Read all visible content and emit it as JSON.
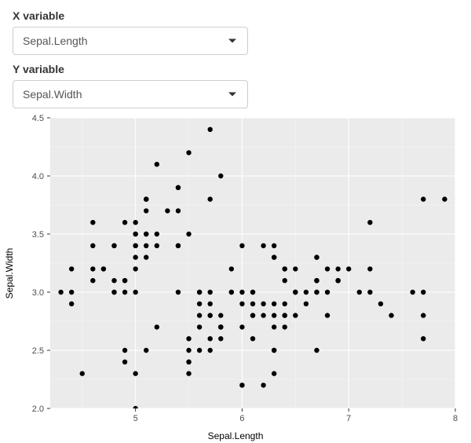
{
  "controls": {
    "x": {
      "label": "X variable",
      "value": "Sepal.Length"
    },
    "y": {
      "label": "Y variable",
      "value": "Sepal.Width"
    }
  },
  "chart_data": {
    "type": "scatter",
    "title": "",
    "xlabel": "Sepal.Length",
    "ylabel": "Sepal.Width",
    "xlim": [
      4.2,
      8.0
    ],
    "ylim": [
      2.0,
      4.5
    ],
    "x_ticks": [
      5,
      6,
      7,
      8
    ],
    "y_ticks": [
      2.0,
      2.5,
      3.0,
      3.5,
      4.0,
      4.5
    ],
    "series": [
      {
        "name": "points",
        "x": [
          5.1,
          4.9,
          4.7,
          4.6,
          5.0,
          5.4,
          4.6,
          5.0,
          4.4,
          4.9,
          5.4,
          4.8,
          4.8,
          4.3,
          5.8,
          5.7,
          5.4,
          5.1,
          5.7,
          5.1,
          5.4,
          5.1,
          4.6,
          5.1,
          4.8,
          5.0,
          5.0,
          5.2,
          5.2,
          4.7,
          4.8,
          5.4,
          5.2,
          5.5,
          4.9,
          5.0,
          5.5,
          4.9,
          4.4,
          5.1,
          5.0,
          4.5,
          4.4,
          5.0,
          5.1,
          4.8,
          5.1,
          4.6,
          5.3,
          5.0,
          7.0,
          6.4,
          6.9,
          5.5,
          6.5,
          5.7,
          6.3,
          4.9,
          6.6,
          5.2,
          5.0,
          5.9,
          6.0,
          6.1,
          5.6,
          6.7,
          5.6,
          5.8,
          6.2,
          5.6,
          5.9,
          6.1,
          6.3,
          6.1,
          6.4,
          6.6,
          6.8,
          6.7,
          6.0,
          5.7,
          5.5,
          5.5,
          5.8,
          6.0,
          5.4,
          6.0,
          6.7,
          6.3,
          5.6,
          5.5,
          5.5,
          6.1,
          5.8,
          5.0,
          5.6,
          5.7,
          5.7,
          6.2,
          5.1,
          5.7,
          6.3,
          5.8,
          7.1,
          6.3,
          6.5,
          7.6,
          4.9,
          7.3,
          6.7,
          7.2,
          6.5,
          6.4,
          6.8,
          5.7,
          5.8,
          6.4,
          6.5,
          7.7,
          7.7,
          6.0,
          6.9,
          5.6,
          7.7,
          6.3,
          6.7,
          7.2,
          6.2,
          6.1,
          6.4,
          7.2,
          7.4,
          7.9,
          6.4,
          6.3,
          6.1,
          7.7,
          6.3,
          6.4,
          6.0,
          6.9,
          6.7,
          6.9,
          5.8,
          6.8,
          6.7,
          6.7,
          6.3,
          6.5,
          6.2,
          5.9
        ],
        "y": [
          3.5,
          3.0,
          3.2,
          3.1,
          3.6,
          3.9,
          3.4,
          3.4,
          2.9,
          3.1,
          3.7,
          3.4,
          3.0,
          3.0,
          4.0,
          4.4,
          3.9,
          3.5,
          3.8,
          3.8,
          3.4,
          3.7,
          3.6,
          3.3,
          3.4,
          3.0,
          3.4,
          3.5,
          3.4,
          3.2,
          3.1,
          3.4,
          4.1,
          4.2,
          3.1,
          3.2,
          3.5,
          3.6,
          3.0,
          3.4,
          3.5,
          2.3,
          3.2,
          3.5,
          3.8,
          3.0,
          3.8,
          3.2,
          3.7,
          3.3,
          3.2,
          3.2,
          3.1,
          2.3,
          2.8,
          2.8,
          3.3,
          2.4,
          2.9,
          2.7,
          2.0,
          3.0,
          2.2,
          2.9,
          2.9,
          3.1,
          3.0,
          2.7,
          2.2,
          2.5,
          3.2,
          2.8,
          2.5,
          2.8,
          2.9,
          3.0,
          2.8,
          3.0,
          2.9,
          2.6,
          2.4,
          2.4,
          2.7,
          2.7,
          3.0,
          3.4,
          3.1,
          2.3,
          3.0,
          2.5,
          2.6,
          3.0,
          2.6,
          2.3,
          2.7,
          3.0,
          2.9,
          2.9,
          2.5,
          2.8,
          3.3,
          2.7,
          3.0,
          2.9,
          3.0,
          3.0,
          2.5,
          2.9,
          2.5,
          3.6,
          3.2,
          2.7,
          3.0,
          2.5,
          2.8,
          3.2,
          3.0,
          3.8,
          2.6,
          2.2,
          3.2,
          2.8,
          2.8,
          2.7,
          3.3,
          3.2,
          2.8,
          3.0,
          2.8,
          3.0,
          2.8,
          3.8,
          2.8,
          2.8,
          2.6,
          3.0,
          3.4,
          3.1,
          3.0,
          3.1,
          3.1,
          3.1,
          2.7,
          3.2,
          3.3,
          3.0,
          2.5,
          3.0,
          3.4,
          3.0
        ]
      }
    ]
  }
}
